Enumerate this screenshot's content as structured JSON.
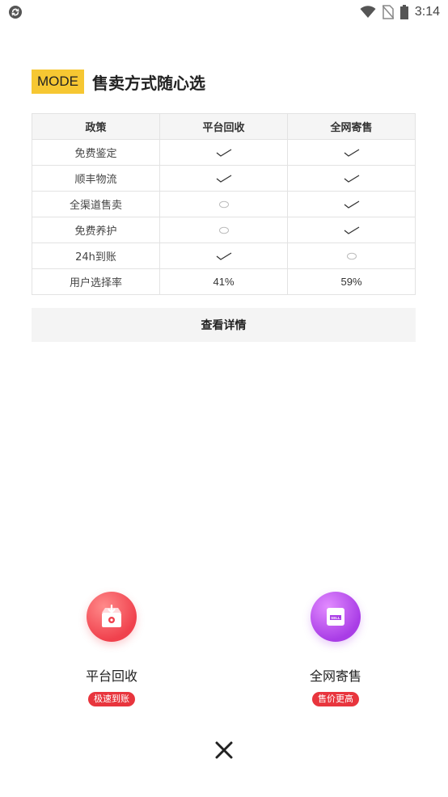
{
  "status_bar": {
    "time": "3:14",
    "icons": [
      "app-sync-icon",
      "wifi-icon",
      "no-sim-icon",
      "battery-icon"
    ]
  },
  "header": {
    "tag": "MODE",
    "title": "售卖方式随心选"
  },
  "table": {
    "headers": [
      "政策",
      "平台回收",
      "全网寄售"
    ],
    "rows": [
      {
        "label": "免费鉴定",
        "platform": "check",
        "consign": "check"
      },
      {
        "label": "顺丰物流",
        "platform": "check",
        "consign": "check"
      },
      {
        "label": "全渠道售卖",
        "platform": "circle",
        "consign": "check"
      },
      {
        "label": "免费养护",
        "platform": "circle",
        "consign": "check"
      },
      {
        "label": "24h到账",
        "platform": "check",
        "consign": "circle"
      }
    ],
    "rate_row": {
      "label": "用户选择率",
      "platform": "41%",
      "consign": "59%"
    }
  },
  "details_button": "查看详情",
  "options": [
    {
      "label": "平台回收",
      "badge": "极速到账",
      "icon": "recycle-box-icon",
      "color": "#f0414d"
    },
    {
      "label": "全网寄售",
      "badge": "售价更高",
      "icon": "sell-tag-icon",
      "color": "#a93de6",
      "icon_text": "SELL"
    }
  ],
  "colors": {
    "accent_yellow": "#f6c732",
    "accent_red": "#e0414a",
    "badge_red": "#e8353d"
  }
}
